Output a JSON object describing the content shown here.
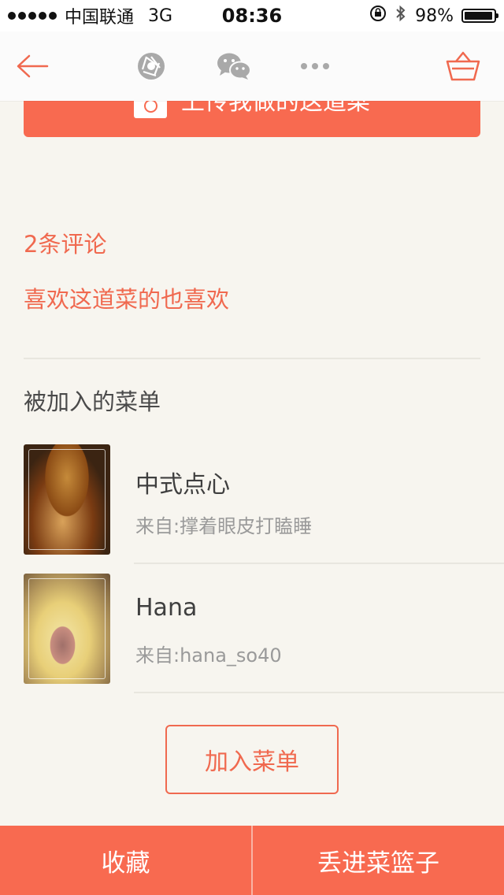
{
  "status_bar": {
    "carrier": "中国联通",
    "network": "3G",
    "time": "08:36",
    "battery_percent": "98%",
    "battery_level": 0.98
  },
  "nav": {
    "icons": [
      "back-arrow-icon",
      "camera-shutter-icon",
      "wechat-icon",
      "more-icon",
      "basket-icon"
    ],
    "accent_color": "#f0694f"
  },
  "upload": {
    "label": "上传我做的这道菜"
  },
  "comments": {
    "label": "2条评论"
  },
  "also_like": {
    "label": "喜欢这道菜的也喜欢"
  },
  "menus_section": {
    "title": "被加入的菜单",
    "items": [
      {
        "title": "中式点心",
        "subtitle": "来自:撑着眼皮打瞌睡"
      },
      {
        "title": "Hana",
        "subtitle": "来自:hana_so40"
      }
    ]
  },
  "add_menu": {
    "label": "加入菜单"
  },
  "bottom_bar": {
    "favorite": "收藏",
    "add_to_basket": "丢进菜篮子",
    "color": "#f86a50"
  }
}
